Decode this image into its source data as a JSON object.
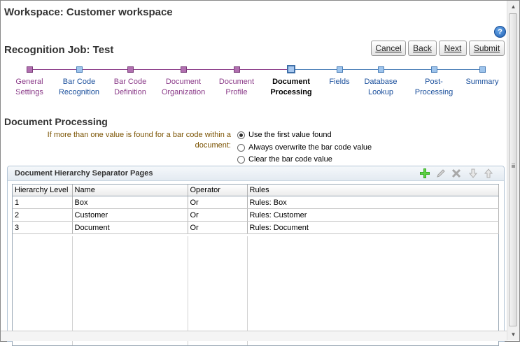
{
  "workspace_title": "Workspace: Customer workspace",
  "help_icon": "?",
  "job_title": "Recognition Job: Test",
  "buttons": {
    "cancel": "Cancel",
    "back": "Back",
    "next": "Next",
    "submit": "Submit"
  },
  "train": [
    {
      "line1": "General",
      "line2": "Settings",
      "state": "visited"
    },
    {
      "line1": "Bar Code",
      "line2": "Recognition",
      "state": "future"
    },
    {
      "line1": "Bar Code",
      "line2": "Definition",
      "state": "visited"
    },
    {
      "line1": "Document",
      "line2": "Organization",
      "state": "visited"
    },
    {
      "line1": "Document",
      "line2": "Profile",
      "state": "visited"
    },
    {
      "line1": "Document",
      "line2": "Processing",
      "state": "current"
    },
    {
      "line1": "Fields",
      "line2": "",
      "state": "future"
    },
    {
      "line1": "Database",
      "line2": "Lookup",
      "state": "future"
    },
    {
      "line1": "Post-Processing",
      "line2": "",
      "state": "future"
    },
    {
      "line1": "Summary",
      "line2": "",
      "state": "future"
    }
  ],
  "section_title": "Document Processing",
  "option_label": "If more than one value is found for a bar code within a document:",
  "radio_options": [
    {
      "label": "Use the first value found",
      "selected": true
    },
    {
      "label": "Always overwrite the bar code value",
      "selected": false
    },
    {
      "label": "Clear the bar code value",
      "selected": false
    }
  ],
  "panel": {
    "title": "Document Hierarchy Separator Pages",
    "tools": [
      "add-icon",
      "edit-icon",
      "delete-icon",
      "move-down-icon",
      "move-up-icon"
    ]
  },
  "table": {
    "headers": [
      "Hierarchy Level",
      "Name",
      "Operator",
      "Rules"
    ],
    "rows": [
      [
        "1",
        "Box",
        "Or",
        "Rules: Box"
      ],
      [
        "2",
        "Customer",
        "Or",
        "Rules: Customer"
      ],
      [
        "3",
        "Document",
        "Or",
        "Rules: Document"
      ]
    ]
  },
  "colors": {
    "visited": "#8a3a88",
    "future": "#1a4f9c",
    "label": "#7a5200"
  }
}
